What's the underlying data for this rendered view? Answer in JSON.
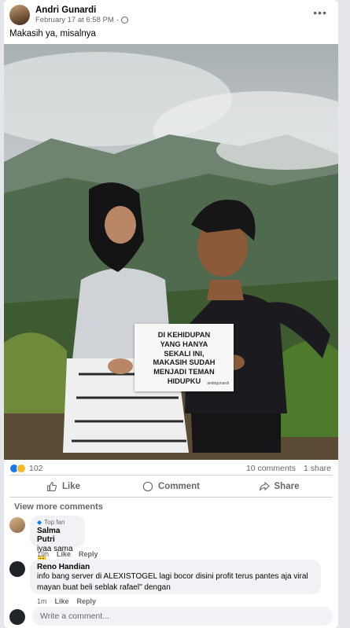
{
  "post": {
    "author": "Andri Gunardi",
    "date": "February 17 at 6:58 PM",
    "separator": "·",
    "more_label": "•••",
    "caption": "Makasih ya, misalnya",
    "sign_lines": [
      "DI KEHIDUPAN",
      "YANG HANYA",
      "SEKALI INI,",
      "MAKASIH SUDAH",
      "MENJADI TEMAN",
      "HIDUPKU"
    ],
    "sign_watermark": "andrigunardi"
  },
  "stats": {
    "reaction_count": "102",
    "comments": "10 comments",
    "shares": "1 share"
  },
  "actions": {
    "like": "Like",
    "comment": "Comment",
    "share": "Share"
  },
  "comments_section": {
    "view_more": "View more comments",
    "items": [
      {
        "badge": "Top fan",
        "name": "Salma Putri",
        "text": "iyaa sama 😄",
        "time": "19h",
        "like": "Like",
        "reply": "Reply"
      },
      {
        "name": "Reno Handian",
        "text_line1": "info bang server di ALEXISTOGEL lagi bocor disini profit terus pantes aja viral",
        "text_line2": "mayan buat beli seblak rafael\" dengan",
        "time": "1m",
        "like": "Like",
        "reply": "Reply"
      }
    ],
    "write_placeholder": "Write a comment..."
  },
  "colors": {
    "accent": "#1877f2",
    "muted": "#65676b",
    "bubble": "#f0f2f5"
  }
}
